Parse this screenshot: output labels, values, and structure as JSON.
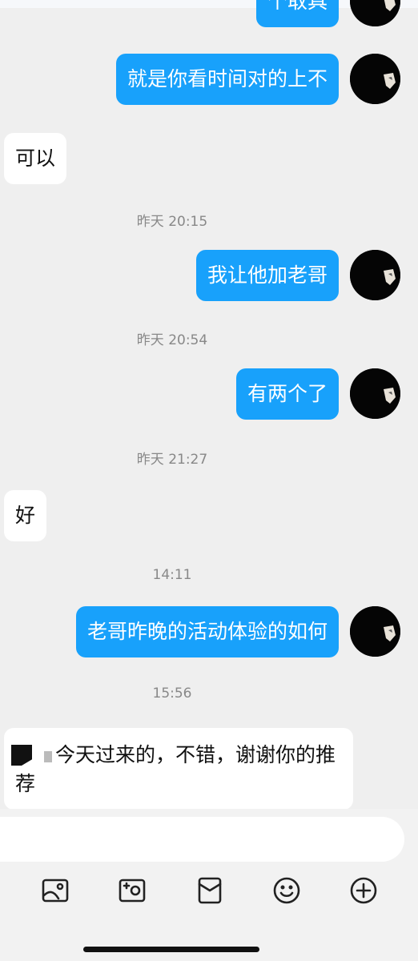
{
  "messages": {
    "partial_top": "个取具",
    "m1": "就是你看时间对的上不",
    "m2": "可以",
    "m3": "我让他加老哥",
    "m4": "有两个了",
    "m5": "好",
    "m6": "老哥昨晚的活动体验的如何",
    "m7": "今天过来的，不错，谢谢你的推荐"
  },
  "timestamps": {
    "t1": "昨天 20:15",
    "t2": "昨天 20:54",
    "t3": "昨天 21:27",
    "t4": "14:11",
    "t5": "15:56"
  },
  "colors": {
    "outgoing_bubble": "#18a1fb",
    "incoming_bubble": "#ffffff",
    "background": "#efefef"
  },
  "toolbar": {
    "icons": [
      "image-icon",
      "camera-icon",
      "red-packet-icon",
      "emoji-icon",
      "plus-icon"
    ]
  }
}
